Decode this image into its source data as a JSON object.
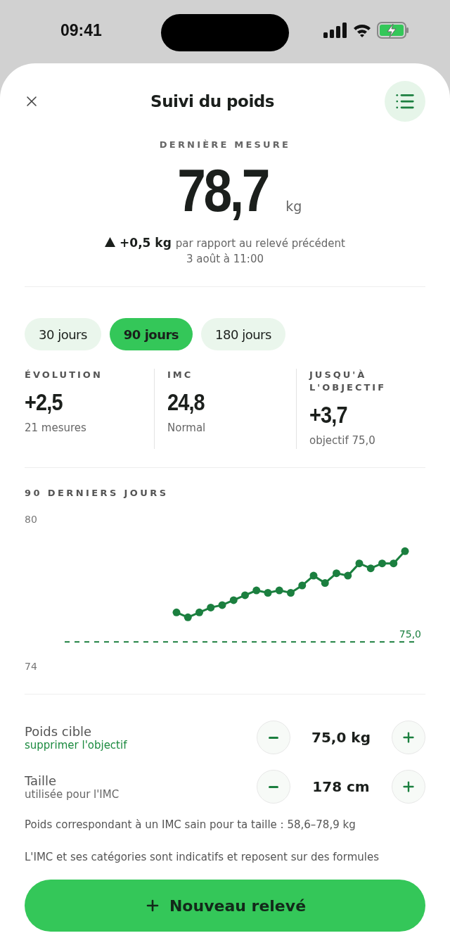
{
  "status_bar": {
    "time": "09:41"
  },
  "header": {
    "title": "Suivi du poids"
  },
  "latest": {
    "label": "DERNIÈRE MESURE",
    "value": "78,7",
    "unit": "kg",
    "delta": "+0,5 kg",
    "delta_text": "par rapport au relevé précédent",
    "date": "3 août à 11:00"
  },
  "periods": [
    {
      "label": "30 jours",
      "selected": false
    },
    {
      "label": "90 jours",
      "selected": true
    },
    {
      "label": "180 jours",
      "selected": false
    }
  ],
  "stats": [
    {
      "label": "ÉVOLUTION",
      "value": "+2,5",
      "note": "21 mesures"
    },
    {
      "label": "IMC",
      "value": "24,8",
      "note": "Normal"
    },
    {
      "label": "JUSQU'À L'OBJECTIF",
      "value": "+3,7",
      "note": "objectif 75,0"
    }
  ],
  "chart": {
    "title": "90 DERNIERS JOURS",
    "chart_data": {
      "type": "line",
      "categories": [
        null,
        null,
        null,
        null,
        null,
        null,
        null,
        null,
        null,
        null,
        null,
        null,
        null,
        null,
        null,
        null,
        null,
        null,
        null,
        null,
        null,
        null,
        null,
        null,
        null,
        null,
        null,
        null,
        null,
        null,
        null
      ],
      "series": [
        {
          "color": "#1b7f3f",
          "marker": true,
          "values": [
            null,
            null,
            null,
            null,
            null,
            null,
            null,
            null,
            null,
            null,
            76.2,
            76.0,
            76.2,
            76.4,
            76.5,
            76.7,
            76.9,
            77.1,
            77.0,
            77.1,
            77.0,
            77.3,
            77.7,
            77.4,
            77.8,
            77.7,
            78.2,
            78.0,
            78.2,
            78.2,
            78.7
          ]
        }
      ],
      "ylim": [
        74,
        80
      ],
      "yticks": [
        74,
        80
      ],
      "ref_lines": [
        {
          "axis": "y",
          "value": 75,
          "label": "75,0"
        }
      ]
    }
  },
  "settings": [
    {
      "kind": "link",
      "label": "Poids cible",
      "sublabel": "supprimer l'objectif",
      "value": "75,0 kg"
    },
    {
      "kind": "note",
      "label": "Taille",
      "sublabel": "utilisée pour l'IMC",
      "value": "178 cm"
    }
  ],
  "info": [
    "Poids correspondant à un IMC sain pour ta taille : 58,6–78,9 kg",
    "L'IMC et ses catégories sont indicatifs et reposent sur des formules"
  ],
  "cta": {
    "label": "Nouveau relevé"
  }
}
